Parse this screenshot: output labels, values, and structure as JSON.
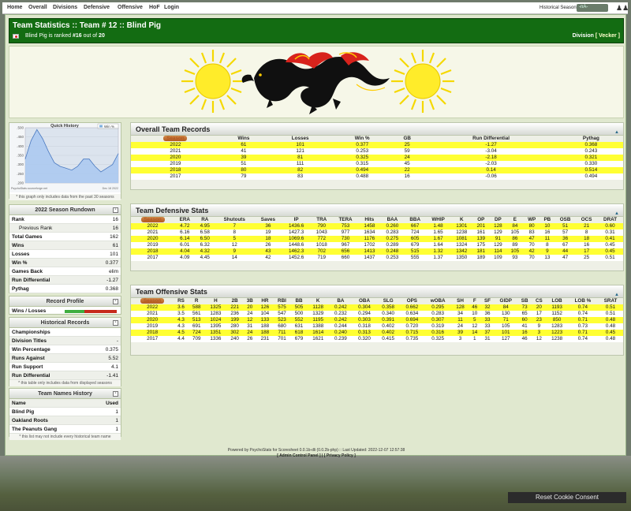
{
  "nav": {
    "items": [
      "Home",
      "Overall",
      "Divisions",
      "Defensive",
      "Offensive",
      "HoF",
      "Login"
    ],
    "seasons_label": "Historical Seasons:",
    "seasons_value": "-nA-"
  },
  "header": {
    "title": "Team Statistics :: Team # 12 :: Blind Pig",
    "subtitle_prefix": "Blind Pig is ranked",
    "rank": "#16",
    "out_of_word": "out of",
    "total": "20",
    "division_label": "Division",
    "division_value": "[ Vecker ]"
  },
  "quick_history": {
    "title": "Quick History",
    "legend": "Win %",
    "yticks": [
      ".500",
      ".450",
      ".400",
      ".350",
      ".300",
      ".250",
      ".200"
    ],
    "values": [
      0.33,
      0.43,
      0.49,
      0.44,
      0.37,
      0.31,
      0.29,
      0.28,
      0.27,
      0.29,
      0.33,
      0.33,
      0.29,
      0.26,
      0.28,
      0.3,
      0.36
    ],
    "caption_left": "PsychoStats.sourceforge.net",
    "caption_right": "Dec 18 2022",
    "note": "* this graph only includes data from the past 30 seasons"
  },
  "rundown": {
    "title": "2022 Season Rundown",
    "rows": [
      {
        "label": "Rank",
        "value": "16"
      },
      {
        "label": "Previous Rank",
        "value": "16",
        "sub": true
      },
      {
        "label": "Total Games",
        "value": "162"
      },
      {
        "label": "Wins",
        "value": "61"
      },
      {
        "label": "Losses",
        "value": "101"
      },
      {
        "label": "Win %",
        "value": "0.377"
      },
      {
        "label": "Games Back",
        "value": "elim"
      },
      {
        "label": "Run Differential",
        "value": "-1.27"
      },
      {
        "label": "Pythag",
        "value": "0.368"
      }
    ]
  },
  "record_profile": {
    "title": "Record Profile",
    "label": "Wins / Losses",
    "wins_frac": 0.377
  },
  "historical": {
    "title": "Historical Records",
    "rows": [
      {
        "label": "Championships",
        "value": ""
      },
      {
        "label": "Division Titles",
        "value": "-"
      },
      {
        "label": "Win Percentage",
        "value": "0.375"
      },
      {
        "label": "Runs Against",
        "value": "5.52"
      },
      {
        "label": "Run Support",
        "value": "4.1"
      },
      {
        "label": "Run Differential",
        "value": "-1.41"
      }
    ],
    "note": "* this table only includes data from displayed seasons"
  },
  "names": {
    "title": "Team Names History",
    "head_name": "Name",
    "head_used": "Used",
    "rows": [
      {
        "name": "Blind Pig",
        "used": "1"
      },
      {
        "name": "Oakland Roots",
        "used": "1"
      },
      {
        "name": "The Peanuts Gang",
        "used": "1"
      }
    ],
    "note": "* this list may not include every historical team name"
  },
  "overall": {
    "title": "Overall Team Records",
    "headers": [
      "Season",
      "Wins",
      "Losses",
      "Win %",
      "GB",
      "Run Differential",
      "Pythag"
    ],
    "rows": [
      [
        "2022",
        "61",
        "101",
        "0.377",
        "25",
        "-1.27",
        "0.368"
      ],
      [
        "2021",
        "41",
        "121",
        "0.253",
        "59",
        "-3.04",
        "0.243"
      ],
      [
        "2020",
        "39",
        "81",
        "0.325",
        "24",
        "-2.18",
        "0.321"
      ],
      [
        "2019",
        "51",
        "111",
        "0.315",
        "45",
        "-2.03",
        "0.330"
      ],
      [
        "2018",
        "80",
        "82",
        "0.494",
        "22",
        "0.14",
        "0.514"
      ],
      [
        "2017",
        "79",
        "83",
        "0.488",
        "16",
        "-0.06",
        "0.494"
      ]
    ]
  },
  "defensive": {
    "title": "Team Defensive Stats",
    "headers": [
      "Season",
      "ERA",
      "RA",
      "Shutouts",
      "Saves",
      "IP",
      "TRA",
      "TERA",
      "Hits",
      "BAA",
      "BBA",
      "WHIP",
      "K",
      "OP",
      "DP",
      "E",
      "WP",
      "PB",
      "OSB",
      "OCS",
      "DRAT"
    ],
    "rows": [
      [
        "2022",
        "4.72",
        "4.95",
        "7",
        "36",
        "1436.6",
        "790",
        "753",
        "1458",
        "0.260",
        "667",
        "1.48",
        "1301",
        "201",
        "128",
        "84",
        "80",
        "10",
        "51",
        "21",
        "0.60"
      ],
      [
        "2021",
        "6.16",
        "6.58",
        "8",
        "19",
        "1427.3",
        "1043",
        "977",
        "1634",
        "0.283",
        "724",
        "1.65",
        "1238",
        "161",
        "129",
        "105",
        "83",
        "16",
        "57",
        "8",
        "0.31"
      ],
      [
        "2020",
        "6.14",
        "6.50",
        "5",
        "18",
        "1069.6",
        "772",
        "730",
        "1176",
        "0.275",
        "605",
        "1.67",
        "1081",
        "139",
        "91",
        "86",
        "47",
        "11",
        "36",
        "18",
        "0.41"
      ],
      [
        "2019",
        "6.01",
        "6.32",
        "12",
        "26",
        "1448.6",
        "1018",
        "967",
        "1702",
        "0.289",
        "679",
        "1.64",
        "1324",
        "175",
        "129",
        "89",
        "70",
        "8",
        "67",
        "16",
        "0.45"
      ],
      [
        "2018",
        "4.04",
        "4.32",
        "9",
        "43",
        "1462.3",
        "702",
        "656",
        "1413",
        "0.248",
        "515",
        "1.32",
        "1342",
        "181",
        "114",
        "105",
        "42",
        "9",
        "44",
        "17",
        "0.45"
      ],
      [
        "2017",
        "4.09",
        "4.45",
        "14",
        "42",
        "1452.6",
        "719",
        "660",
        "1437",
        "0.253",
        "555",
        "1.37",
        "1350",
        "189",
        "109",
        "93",
        "70",
        "13",
        "47",
        "25",
        "0.51"
      ]
    ]
  },
  "offensive": {
    "title": "Team Offensive Stats",
    "headers": [
      "Season",
      "RS",
      "R",
      "H",
      "2B",
      "3B",
      "HR",
      "RBI",
      "BB",
      "K",
      "BA",
      "OBA",
      "SLG",
      "OPS",
      "wOBA",
      "SH",
      "F",
      "SF",
      "GIDP",
      "SB",
      "CS",
      "LOB",
      "LOB %",
      "SRAT"
    ],
    "rows": [
      [
        "2022",
        "3.6",
        "588",
        "1325",
        "221",
        "20",
        "126",
        "575",
        "505",
        "1128",
        "0.242",
        "0.304",
        "0.358",
        "0.662",
        "0.295",
        "128",
        "46",
        "32",
        "84",
        "73",
        "20",
        "1193",
        "0.74",
        "0.51"
      ],
      [
        "2021",
        "3.5",
        "561",
        "1283",
        "236",
        "24",
        "104",
        "547",
        "500",
        "1329",
        "0.232",
        "0.294",
        "0.340",
        "0.634",
        "0.283",
        "34",
        "10",
        "36",
        "130",
        "65",
        "17",
        "1152",
        "0.74",
        "0.51"
      ],
      [
        "2020",
        "4.3",
        "513",
        "1024",
        "199",
        "12",
        "133",
        "523",
        "552",
        "1195",
        "0.242",
        "0.303",
        "0.391",
        "0.694",
        "0.307",
        "11",
        "5",
        "33",
        "71",
        "60",
        "23",
        "850",
        "0.71",
        "0.48"
      ],
      [
        "2019",
        "4.3",
        "691",
        "1395",
        "280",
        "31",
        "188",
        "680",
        "631",
        "1388",
        "0.244",
        "0.318",
        "0.402",
        "0.720",
        "0.319",
        "24",
        "12",
        "33",
        "105",
        "41",
        "9",
        "1283",
        "0.73",
        "0.48"
      ],
      [
        "2018",
        "4.5",
        "724",
        "1351",
        "302",
        "24",
        "188",
        "711",
        "618",
        "1614",
        "0.240",
        "0.313",
        "0.402",
        "0.715",
        "0.316",
        "39",
        "14",
        "37",
        "101",
        "16",
        "3",
        "1223",
        "0.71",
        "0.45"
      ],
      [
        "2017",
        "4.4",
        "709",
        "1336",
        "240",
        "26",
        "231",
        "701",
        "679",
        "1621",
        "0.239",
        "0.320",
        "0.415",
        "0.735",
        "0.325",
        "3",
        "1",
        "31",
        "127",
        "46",
        "12",
        "1238",
        "0.74",
        "0.48"
      ]
    ]
  },
  "footer": {
    "line1": "Powered by PsychoStats for Scoresheet 0.0.1b-dli (0.0.2b-php)  ::  Last Updated: 2022-12-07 12:57:38",
    "admin": "[ Admin Control Panel ]",
    "privacy": "[ Privacy Policy ]"
  },
  "cookie": {
    "label": "Reset Cookie Consent"
  }
}
